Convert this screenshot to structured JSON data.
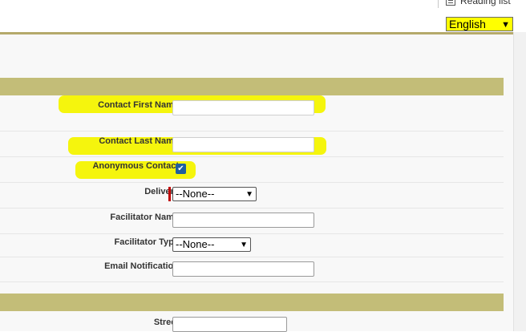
{
  "browser": {
    "reading_list_label": "Reading list"
  },
  "language": {
    "selected": "English"
  },
  "form": {
    "contact_first_name_label": "Contact First Name",
    "contact_last_name_label": "Contact Last Name",
    "anonymous_contact_label": "Anonymous Contact",
    "anonymous_contact_checked": true,
    "delivery_label": "Delivery",
    "delivery_value": "--None--",
    "facilitator_name_label": "Facilitator Name",
    "facilitator_type_label": "Facilitator Type",
    "facilitator_type_value": "--None--",
    "email_notification_label": "Email Notification",
    "street_label": "Street"
  },
  "colors": {
    "section_bar": "#c3bd78",
    "highlight": "#f4f400",
    "required": "#c00000"
  }
}
